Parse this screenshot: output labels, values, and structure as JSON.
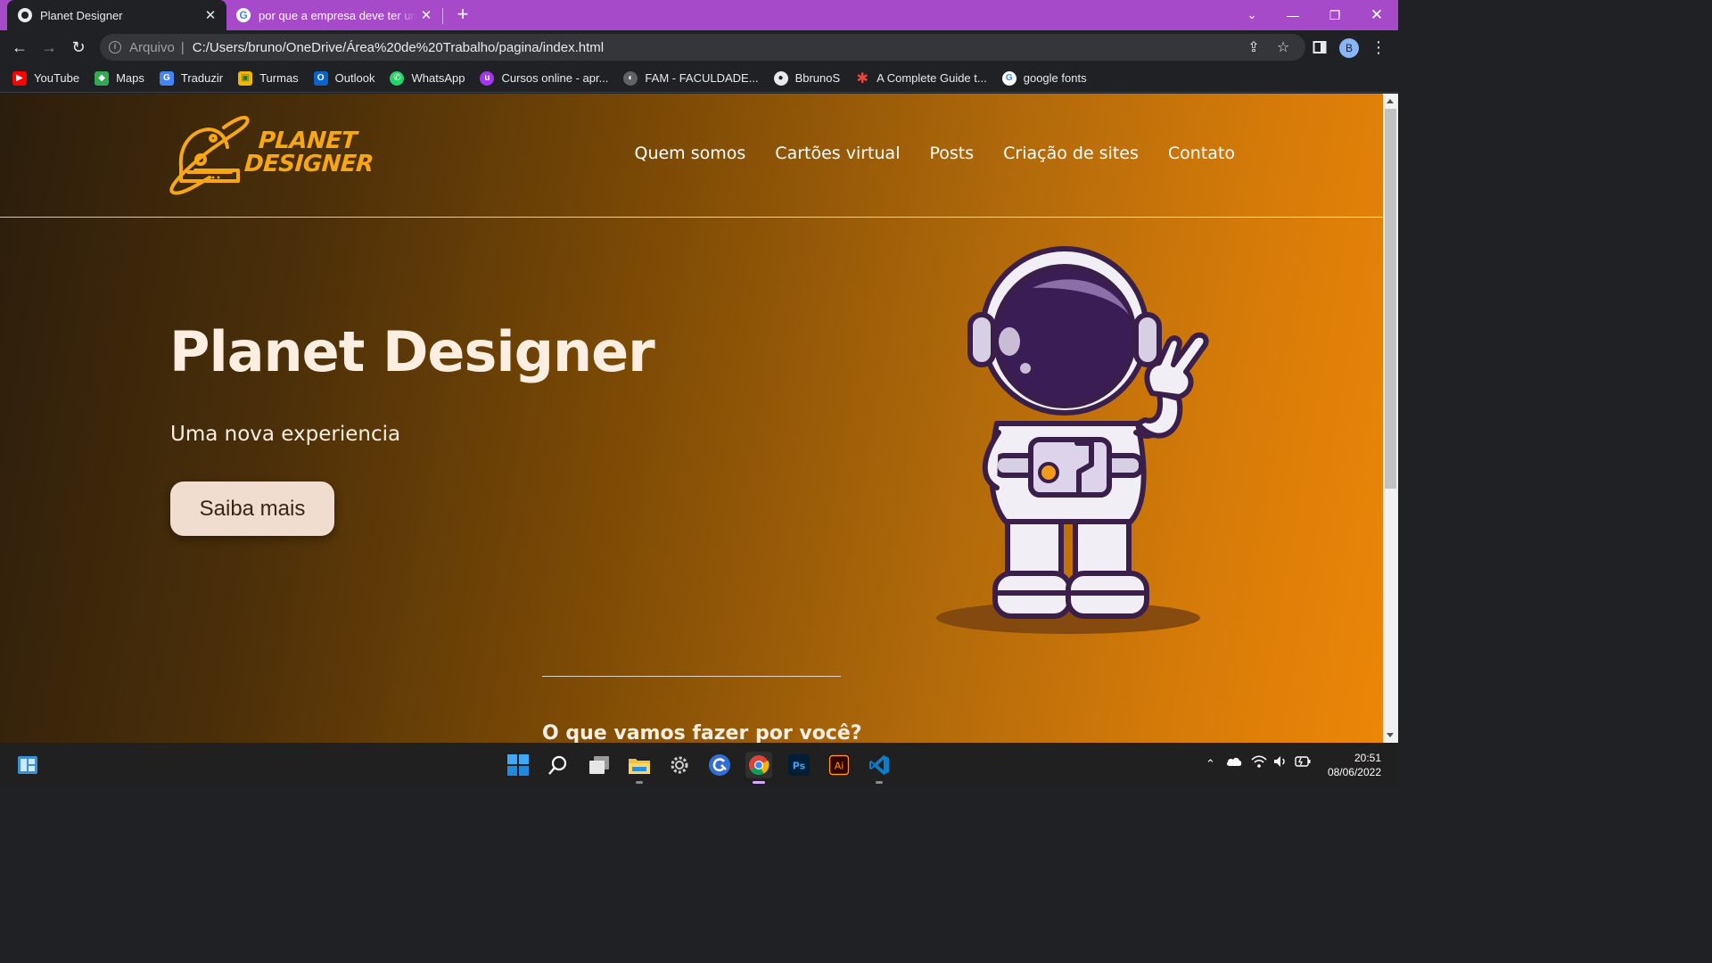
{
  "browser": {
    "tabs": [
      {
        "title": "Planet Designer",
        "favicon": "globe-icon",
        "active": true
      },
      {
        "title": "por que a empresa deve ter um cartão virtual",
        "favicon": "google-icon",
        "active": false
      }
    ],
    "address": {
      "scheme": "Arquivo",
      "url": "C:/Users/bruno/OneDrive/Área%20de%20Trabalho/pagina/index.html"
    },
    "profile_initial": "B",
    "bookmarks": [
      {
        "label": "YouTube",
        "icon": "youtube-icon",
        "color": "#ff0000"
      },
      {
        "label": "Maps",
        "icon": "maps-icon",
        "color": "#34a853"
      },
      {
        "label": "Traduzir",
        "icon": "translate-icon",
        "color": "#4285f4"
      },
      {
        "label": "Turmas",
        "icon": "classroom-icon",
        "color": "#f4b400"
      },
      {
        "label": "Outlook",
        "icon": "outlook-icon",
        "color": "#0a64c9"
      },
      {
        "label": "WhatsApp",
        "icon": "whatsapp-icon",
        "color": "#25d366"
      },
      {
        "label": "Cursos online - apr...",
        "icon": "udemy-icon",
        "color": "#a435f0"
      },
      {
        "label": "FAM - FACULDADE...",
        "icon": "globe-icon",
        "color": "#9aa0a6"
      },
      {
        "label": "BbrunoS",
        "icon": "github-icon",
        "color": "#e8eaed"
      },
      {
        "label": "A Complete Guide t...",
        "icon": "asterisk-icon",
        "color": "#e8453c"
      },
      {
        "label": "google fonts",
        "icon": "google-icon",
        "color": "#ffffff"
      }
    ]
  },
  "site": {
    "logo": {
      "line1": "PLANET",
      "line2": "DESIGNER",
      "color": "#f7a614"
    },
    "nav": [
      "Quem somos",
      "Cartões virtual",
      "Posts",
      "Criação de sites",
      "Contato"
    ],
    "hero": {
      "title": "Planet Designer",
      "subtitle": "Uma nova experiencia",
      "cta": "Saiba mais"
    },
    "section_title": "O que vamos fazer por você?"
  },
  "taskbar": {
    "apps": [
      "start-icon",
      "search-icon",
      "task-view-icon",
      "file-explorer-icon",
      "settings-icon",
      "app-icon",
      "chrome-icon",
      "photoshop-icon",
      "illustrator-icon",
      "vscode-icon"
    ],
    "time": "20:51",
    "date": "08/06/2022"
  }
}
